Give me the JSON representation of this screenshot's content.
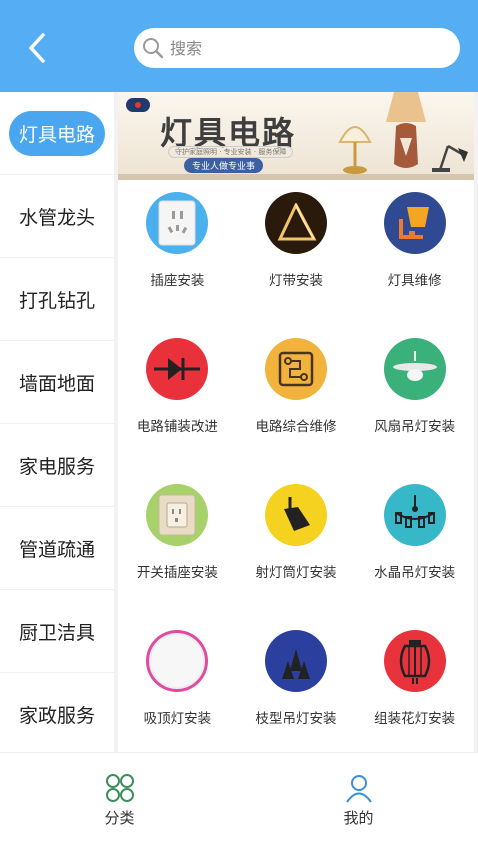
{
  "header": {
    "back_icon": "chevron-left-icon",
    "search": {
      "placeholder": "搜索",
      "value": ""
    }
  },
  "sidebar": {
    "active_index": 0,
    "items": [
      {
        "label": "灯具电路",
        "active": true
      },
      {
        "label": "水管龙头"
      },
      {
        "label": "打孔钻孔"
      },
      {
        "label": "墙面地面"
      },
      {
        "label": "家电服务"
      },
      {
        "label": "管道疏通"
      },
      {
        "label": "厨卫洁具"
      },
      {
        "label": "家政服务"
      }
    ]
  },
  "banner": {
    "title": "灯具电路",
    "subtitle": "守护家庭照明 · 专业安装 · 服务保障",
    "tagline": "专业人做专业事"
  },
  "services": [
    {
      "label": "插座安装",
      "icon": "socket-icon"
    },
    {
      "label": "灯带安装",
      "icon": "light-strip-icon"
    },
    {
      "label": "灯具维修",
      "icon": "lamp-repair-icon"
    },
    {
      "label": "电路铺装改进",
      "icon": "diode-icon"
    },
    {
      "label": "电路综合维修",
      "icon": "circuit-board-icon"
    },
    {
      "label": "风扇吊灯安装",
      "icon": "fan-light-icon"
    },
    {
      "label": "开关插座安装",
      "icon": "switch-socket-icon"
    },
    {
      "label": "射灯筒灯安装",
      "icon": "spotlight-icon"
    },
    {
      "label": "水晶吊灯安装",
      "icon": "chandelier-icon"
    },
    {
      "label": "吸顶灯安装",
      "icon": "ceiling-light-icon"
    },
    {
      "label": "枝型吊灯安装",
      "icon": "branch-chandelier-icon"
    },
    {
      "label": "组装花灯安装",
      "icon": "lantern-icon"
    }
  ],
  "tabbar": [
    {
      "label": "分类",
      "icon": "grid-category-icon",
      "color": "#3c8f5a"
    },
    {
      "label": "我的",
      "icon": "user-icon",
      "color": "#3a8fd8"
    }
  ],
  "colors": {
    "header": "#55aef4",
    "accent": "#4aa7ef"
  }
}
